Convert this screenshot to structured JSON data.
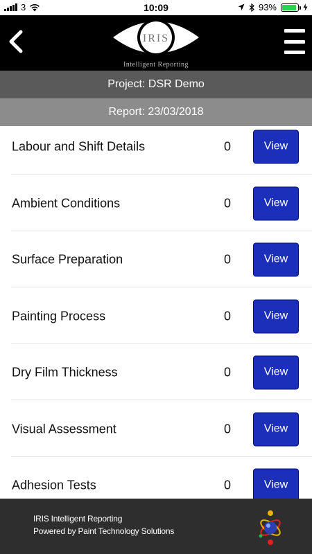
{
  "status_bar": {
    "carrier": "3",
    "time": "10:09",
    "battery_percent": "93%",
    "battery_level": 0.93,
    "battery_color": "#2bd24a",
    "icons": [
      "signal-icon",
      "wifi-icon",
      "location-icon",
      "bluetooth-icon",
      "battery-icon",
      "charging-icon"
    ]
  },
  "header": {
    "logo_text": "IRIS",
    "logo_subtitle": "Intelligent Reporting",
    "back_icon": "chevron-left-icon",
    "menu_icon": "hamburger-menu-icon"
  },
  "project_bar": {
    "text": "Project: DSR Demo"
  },
  "report_bar": {
    "text": "Report: 23/03/2018"
  },
  "sections": [
    {
      "label": "Labour and Shift Details",
      "count": "0",
      "button": "View"
    },
    {
      "label": "Ambient Conditions",
      "count": "0",
      "button": "View"
    },
    {
      "label": "Surface Preparation",
      "count": "0",
      "button": "View"
    },
    {
      "label": "Painting Process",
      "count": "0",
      "button": "View"
    },
    {
      "label": "Dry Film Thickness",
      "count": "0",
      "button": "View"
    },
    {
      "label": "Visual Assessment",
      "count": "0",
      "button": "View"
    },
    {
      "label": "Adhesion Tests",
      "count": "0",
      "button": "View"
    }
  ],
  "footer": {
    "line1": "IRIS Intelligent Reporting",
    "line2": "Powered by Paint Technology Solutions",
    "logo_icon": "paint-technology-solutions-logo"
  },
  "colors": {
    "header_bg": "#000000",
    "project_bar_bg": "#5a5a5a",
    "report_bar_bg": "#8c8c8c",
    "button_bg": "#1b2fbb",
    "footer_bg": "#2e2e2e"
  }
}
